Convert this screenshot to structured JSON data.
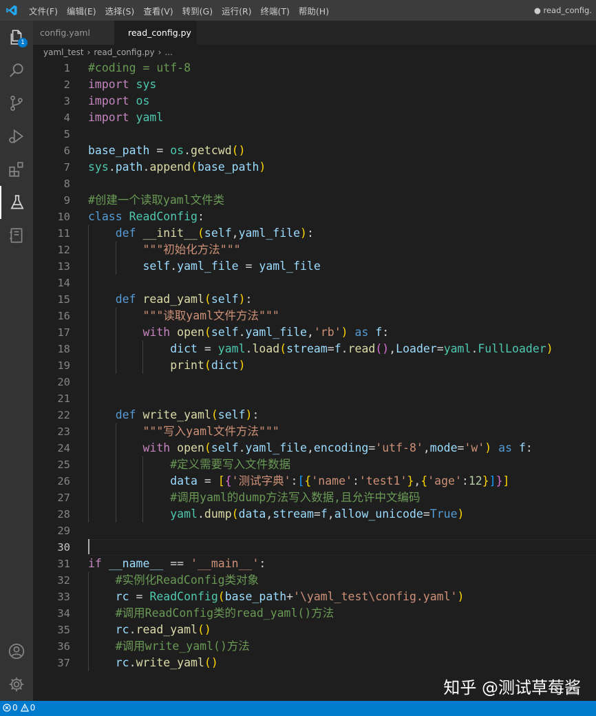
{
  "titlebar": {
    "menu": [
      "文件(F)",
      "编辑(E)",
      "选择(S)",
      "查看(V)",
      "转到(G)",
      "运行(R)",
      "终端(T)",
      "帮助(H)"
    ],
    "window_title": "● read_config."
  },
  "activitybar": {
    "explorer_badge": "1",
    "icons": [
      "files-icon",
      "search-icon",
      "source-control-icon",
      "run-debug-icon",
      "extensions-icon",
      "testing-icon",
      "notebook-icon",
      "account-icon",
      "settings-gear-icon"
    ]
  },
  "tabs": [
    {
      "label": "config.yaml",
      "active": false
    },
    {
      "label": "read_config.py",
      "active": true,
      "dirty": true
    }
  ],
  "breadcrumb": [
    "yaml_test",
    "read_config.py",
    "..."
  ],
  "editor": {
    "current_line": 30,
    "lines": [
      [
        [
          "#coding = utf-8",
          "cmt"
        ]
      ],
      [
        [
          "import",
          "kw"
        ],
        [
          " ",
          ""
        ],
        [
          "sys",
          "cls"
        ]
      ],
      [
        [
          "import",
          "kw"
        ],
        [
          " ",
          ""
        ],
        [
          "os",
          "cls"
        ]
      ],
      [
        [
          "import",
          "kw"
        ],
        [
          " ",
          ""
        ],
        [
          "yaml",
          "cls"
        ]
      ],
      [],
      [
        [
          "base_path",
          "var"
        ],
        [
          " = ",
          ""
        ],
        [
          "os",
          "cls"
        ],
        [
          ".",
          ""
        ],
        [
          "getcwd",
          "fn"
        ],
        [
          "()",
          "b1"
        ]
      ],
      [
        [
          "sys",
          "cls"
        ],
        [
          ".",
          ""
        ],
        [
          "path",
          "var"
        ],
        [
          ".",
          ""
        ],
        [
          "append",
          "fn"
        ],
        [
          "(",
          "b1"
        ],
        [
          "base_path",
          "var"
        ],
        [
          ")",
          "b1"
        ]
      ],
      [],
      [
        [
          "#创建一个读取yaml文件类",
          "cmt"
        ]
      ],
      [
        [
          "class",
          "kwb"
        ],
        [
          " ",
          ""
        ],
        [
          "ReadConfig",
          "cls"
        ],
        [
          ":",
          ""
        ]
      ],
      [
        [
          "    ",
          ""
        ],
        [
          "def",
          "kwb"
        ],
        [
          " ",
          ""
        ],
        [
          "__init__",
          "fn"
        ],
        [
          "(",
          "b1"
        ],
        [
          "self",
          "var"
        ],
        [
          ",",
          ""
        ],
        [
          "yaml_file",
          "var"
        ],
        [
          ")",
          "b1"
        ],
        [
          ":",
          ""
        ]
      ],
      [
        [
          "        ",
          ""
        ],
        [
          "\"\"\"初始化方法\"\"\"",
          "str"
        ]
      ],
      [
        [
          "        ",
          ""
        ],
        [
          "self",
          "var"
        ],
        [
          ".",
          ""
        ],
        [
          "yaml_file",
          "var"
        ],
        [
          " = ",
          ""
        ],
        [
          "yaml_file",
          "var"
        ]
      ],
      [],
      [
        [
          "    ",
          ""
        ],
        [
          "def",
          "kwb"
        ],
        [
          " ",
          ""
        ],
        [
          "read_yaml",
          "fn"
        ],
        [
          "(",
          "b1"
        ],
        [
          "self",
          "var"
        ],
        [
          ")",
          "b1"
        ],
        [
          ":",
          ""
        ]
      ],
      [
        [
          "        ",
          ""
        ],
        [
          "\"\"\"读取yaml文件方法\"\"\"",
          "str"
        ]
      ],
      [
        [
          "        ",
          ""
        ],
        [
          "with",
          "kw"
        ],
        [
          " ",
          ""
        ],
        [
          "open",
          "fn"
        ],
        [
          "(",
          "b1"
        ],
        [
          "self",
          "var"
        ],
        [
          ".",
          ""
        ],
        [
          "yaml_file",
          "var"
        ],
        [
          ",",
          ""
        ],
        [
          "'rb'",
          "str"
        ],
        [
          ")",
          "b1"
        ],
        [
          " ",
          ""
        ],
        [
          "as",
          "kwb"
        ],
        [
          " ",
          ""
        ],
        [
          "f",
          "var"
        ],
        [
          ":",
          ""
        ]
      ],
      [
        [
          "            ",
          ""
        ],
        [
          "dict",
          "var"
        ],
        [
          " = ",
          ""
        ],
        [
          "yaml",
          "cls"
        ],
        [
          ".",
          ""
        ],
        [
          "load",
          "fn"
        ],
        [
          "(",
          "b1"
        ],
        [
          "stream",
          "var"
        ],
        [
          "=",
          ""
        ],
        [
          "f",
          "var"
        ],
        [
          ".",
          ""
        ],
        [
          "read",
          "fn"
        ],
        [
          "()",
          "b2"
        ],
        [
          ",",
          ""
        ],
        [
          "Loader",
          "var"
        ],
        [
          "=",
          ""
        ],
        [
          "yaml",
          "cls"
        ],
        [
          ".",
          ""
        ],
        [
          "FullLoader",
          "cls"
        ],
        [
          ")",
          "b1"
        ]
      ],
      [
        [
          "            ",
          ""
        ],
        [
          "print",
          "fn"
        ],
        [
          "(",
          "b1"
        ],
        [
          "dict",
          "var"
        ],
        [
          ")",
          "b1"
        ]
      ],
      [],
      [],
      [
        [
          "    ",
          ""
        ],
        [
          "def",
          "kwb"
        ],
        [
          " ",
          ""
        ],
        [
          "write_yaml",
          "fn"
        ],
        [
          "(",
          "b1"
        ],
        [
          "self",
          "var"
        ],
        [
          ")",
          "b1"
        ],
        [
          ":",
          ""
        ]
      ],
      [
        [
          "        ",
          ""
        ],
        [
          "\"\"\"写入yaml文件方法\"\"\"",
          "str"
        ]
      ],
      [
        [
          "        ",
          ""
        ],
        [
          "with",
          "kw"
        ],
        [
          " ",
          ""
        ],
        [
          "open",
          "fn"
        ],
        [
          "(",
          "b1"
        ],
        [
          "self",
          "var"
        ],
        [
          ".",
          ""
        ],
        [
          "yaml_file",
          "var"
        ],
        [
          ",",
          ""
        ],
        [
          "encoding",
          "var"
        ],
        [
          "=",
          ""
        ],
        [
          "'utf-8'",
          "str"
        ],
        [
          ",",
          ""
        ],
        [
          "mode",
          "var"
        ],
        [
          "=",
          ""
        ],
        [
          "'w'",
          "str"
        ],
        [
          ")",
          "b1"
        ],
        [
          " ",
          ""
        ],
        [
          "as",
          "kwb"
        ],
        [
          " ",
          ""
        ],
        [
          "f",
          "var"
        ],
        [
          ":",
          ""
        ]
      ],
      [
        [
          "            ",
          ""
        ],
        [
          "#定义需要写入文件数据",
          "cmt"
        ]
      ],
      [
        [
          "            ",
          ""
        ],
        [
          "data",
          "var"
        ],
        [
          " = ",
          ""
        ],
        [
          "[",
          "b1"
        ],
        [
          "{",
          "b2"
        ],
        [
          "'测试字典'",
          "str"
        ],
        [
          ":",
          ""
        ],
        [
          "[",
          "b3"
        ],
        [
          "{",
          "b1"
        ],
        [
          "'name'",
          "str"
        ],
        [
          ":",
          ""
        ],
        [
          "'test1'",
          "str"
        ],
        [
          "}",
          "b1"
        ],
        [
          ",",
          ""
        ],
        [
          "{",
          "b1"
        ],
        [
          "'age'",
          "str"
        ],
        [
          ":",
          ""
        ],
        [
          "12",
          "num"
        ],
        [
          "}",
          "b1"
        ],
        [
          "]",
          "b3"
        ],
        [
          "}",
          "b2"
        ],
        [
          "]",
          "b1"
        ]
      ],
      [
        [
          "            ",
          ""
        ],
        [
          "#调用yaml的dump方法写入数据,且允许中文编码",
          "cmt"
        ]
      ],
      [
        [
          "            ",
          ""
        ],
        [
          "yaml",
          "cls"
        ],
        [
          ".",
          ""
        ],
        [
          "dump",
          "fn"
        ],
        [
          "(",
          "b1"
        ],
        [
          "data",
          "var"
        ],
        [
          ",",
          ""
        ],
        [
          "stream",
          "var"
        ],
        [
          "=",
          ""
        ],
        [
          "f",
          "var"
        ],
        [
          ",",
          ""
        ],
        [
          "allow_unicode",
          "var"
        ],
        [
          "=",
          ""
        ],
        [
          "True",
          "kwb"
        ],
        [
          ")",
          "b1"
        ]
      ],
      [],
      [],
      [
        [
          "if",
          "kw"
        ],
        [
          " ",
          ""
        ],
        [
          "__name__",
          "var"
        ],
        [
          " == ",
          ""
        ],
        [
          "'__main__'",
          "str"
        ],
        [
          ":",
          ""
        ]
      ],
      [
        [
          "    ",
          ""
        ],
        [
          "#实例化ReadConfig类对象",
          "cmt"
        ]
      ],
      [
        [
          "    ",
          ""
        ],
        [
          "rc",
          "var"
        ],
        [
          " = ",
          ""
        ],
        [
          "ReadConfig",
          "cls"
        ],
        [
          "(",
          "b1"
        ],
        [
          "base_path",
          "var"
        ],
        [
          "+",
          ""
        ],
        [
          "'\\yaml_test\\config.yaml'",
          "str"
        ],
        [
          ")",
          "b1"
        ]
      ],
      [
        [
          "    ",
          ""
        ],
        [
          "#调用ReadConfig类的read_yaml()方法",
          "cmt"
        ]
      ],
      [
        [
          "    ",
          ""
        ],
        [
          "rc",
          "var"
        ],
        [
          ".",
          ""
        ],
        [
          "read_yaml",
          "fn"
        ],
        [
          "()",
          "b1"
        ]
      ],
      [
        [
          "    ",
          ""
        ],
        [
          "#调用write_yaml()方法",
          "cmt"
        ]
      ],
      [
        [
          "    ",
          ""
        ],
        [
          "rc",
          "var"
        ],
        [
          ".",
          ""
        ],
        [
          "write_yaml",
          "fn"
        ],
        [
          "()",
          "b1"
        ]
      ]
    ]
  },
  "watermark": "知乎 @测试草莓酱",
  "statusbar": {
    "errors": "0",
    "warnings": "0"
  }
}
